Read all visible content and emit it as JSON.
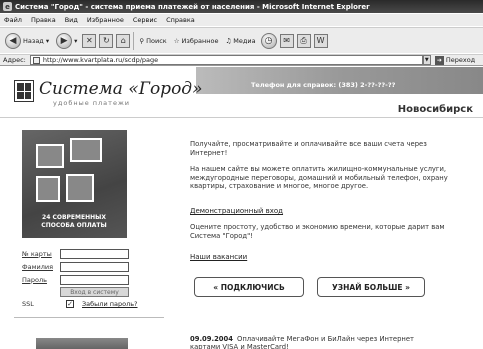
{
  "browser": {
    "title": "Система \"Город\" - система приема платежей от населения - Microsoft Internet Explorer",
    "menu": [
      "Файл",
      "Правка",
      "Вид",
      "Избранное",
      "Сервис",
      "Справка"
    ],
    "toolbar": {
      "back_label": "Назад",
      "search_label": "Поиск",
      "favorites_label": "Избранное",
      "media_label": "Медиа"
    },
    "address_label": "Адрес:",
    "url": "http://www.kvartplata.ru/scdp/page",
    "go_label": "Переход"
  },
  "site": {
    "logo_title": "Система «Город»",
    "logo_subtitle": "удобные платежи",
    "banner_phone": "Телефон для справок: (383) 2-??-??-??",
    "city": "Новосибирск",
    "promo_caption": "24 СОВРЕМЕННЫХ СПОСОБА ОПЛАТЫ",
    "intro_1": "Получайте, просматривайте и оплачивайте все ваши счета через Интернет!",
    "intro_2": "На нашем сайте вы можете оплатить жилищно-коммунальные услуги, междугородные переговоры, домашний и мобильный телефон, охрану квартиры, страхование и многое, многое другое.",
    "demo_link": "Демонстрационный вход",
    "rate_text": "Оцените простоту, удобство и экономию времени, которые дарит вам Система \"Город\"!",
    "vacancies_link": "Наши вакансии",
    "cta_connect": "« ПОДКЛЮЧИСЬ",
    "cta_more": "УЗНАЙ БОЛЬШЕ »",
    "login": {
      "card_label": "№ карты",
      "surname_label": "Фамилия",
      "password_label": "Пароль",
      "submit_label": "Вход в систему",
      "ssl_label": "SSL",
      "ssl_checked": "✓",
      "forgot_link": "Забыли пароль?"
    },
    "news": {
      "date": "09.09.2004",
      "text": "Оплачивайте МегаФон и БиЛайн через Интернет картами VISA и MasterCard!"
    }
  }
}
